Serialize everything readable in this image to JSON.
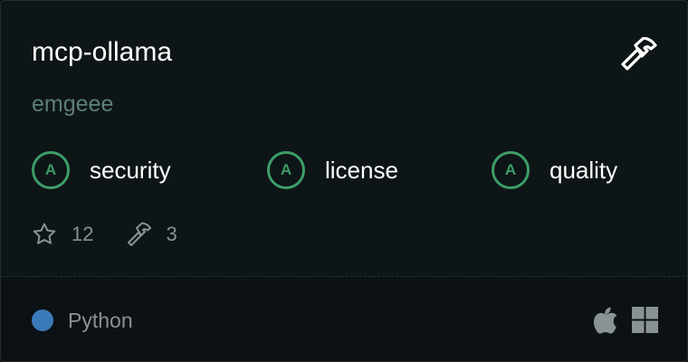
{
  "card": {
    "title": "mcp-ollama",
    "author": "emgeee",
    "grades": [
      {
        "grade": "A",
        "label": "security"
      },
      {
        "grade": "A",
        "label": "license"
      },
      {
        "grade": "A",
        "label": "quality"
      }
    ],
    "stats": {
      "stars": "12",
      "tools": "3"
    },
    "language": {
      "name": "Python",
      "color": "#3b7ab8"
    },
    "platforms": [
      "apple-icon",
      "windows-icon"
    ],
    "icons": {
      "header": "hammer-icon",
      "stars": "star-icon",
      "tools": "hammer-icon"
    },
    "colors": {
      "grade_accent": "#3d9d68",
      "author": "#5d7f78"
    }
  }
}
